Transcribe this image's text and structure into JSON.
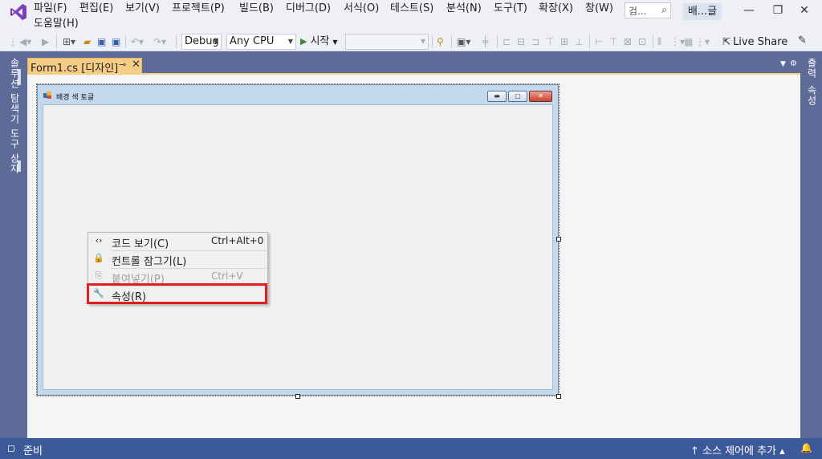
{
  "menu": {
    "items": [
      "파일(F)",
      "편집(E)",
      "보기(V)",
      "프로젝트(P)",
      "빌드(B)",
      "디버그(D)",
      "서식(O)",
      "테스트(S)",
      "분석(N)",
      "도구(T)",
      "확장(X)",
      "창(W)",
      "도움말(H)"
    ]
  },
  "search": {
    "placeholder": "검...",
    "icon": "search-icon"
  },
  "solution_name": "배...글",
  "window_controls": {
    "minimize": "—",
    "restore": "❐",
    "close": "✕"
  },
  "toolbar": {
    "config": "Debug",
    "platform": "Any CPU",
    "start_label": "시작",
    "live_share": "Live Share"
  },
  "side_tabs": {
    "left": [
      "솔루션 탐색기",
      "도구 상자"
    ],
    "right": [
      "출력",
      "속성"
    ]
  },
  "doc_tab": {
    "title": "Form1.cs [디자인]",
    "pin": "⊸",
    "close": "✕"
  },
  "form": {
    "title": "배경 색 토글"
  },
  "context_menu": {
    "items": [
      {
        "label": "코드 보기(C)",
        "shortcut": "Ctrl+Alt+0",
        "icon": "code-icon",
        "enabled": true
      },
      {
        "label": "컨트롤 잠그기(L)",
        "shortcut": "",
        "icon": "lock-icon",
        "enabled": true
      },
      {
        "label": "붙여넣기(P)",
        "shortcut": "Ctrl+V",
        "icon": "paste-icon",
        "enabled": false
      },
      {
        "label": "속성(R)",
        "shortcut": "",
        "icon": "wrench-icon",
        "enabled": true
      }
    ],
    "highlighted_item": "속성(R)",
    "highlight_color": "#e0201c"
  },
  "status": {
    "text": "준비",
    "source_control": "소스 제어에 추가"
  },
  "colors": {
    "accent_tab": "#f5cc84",
    "statusbar": "#3c5a99",
    "ide_frame": "#5d6b99"
  }
}
